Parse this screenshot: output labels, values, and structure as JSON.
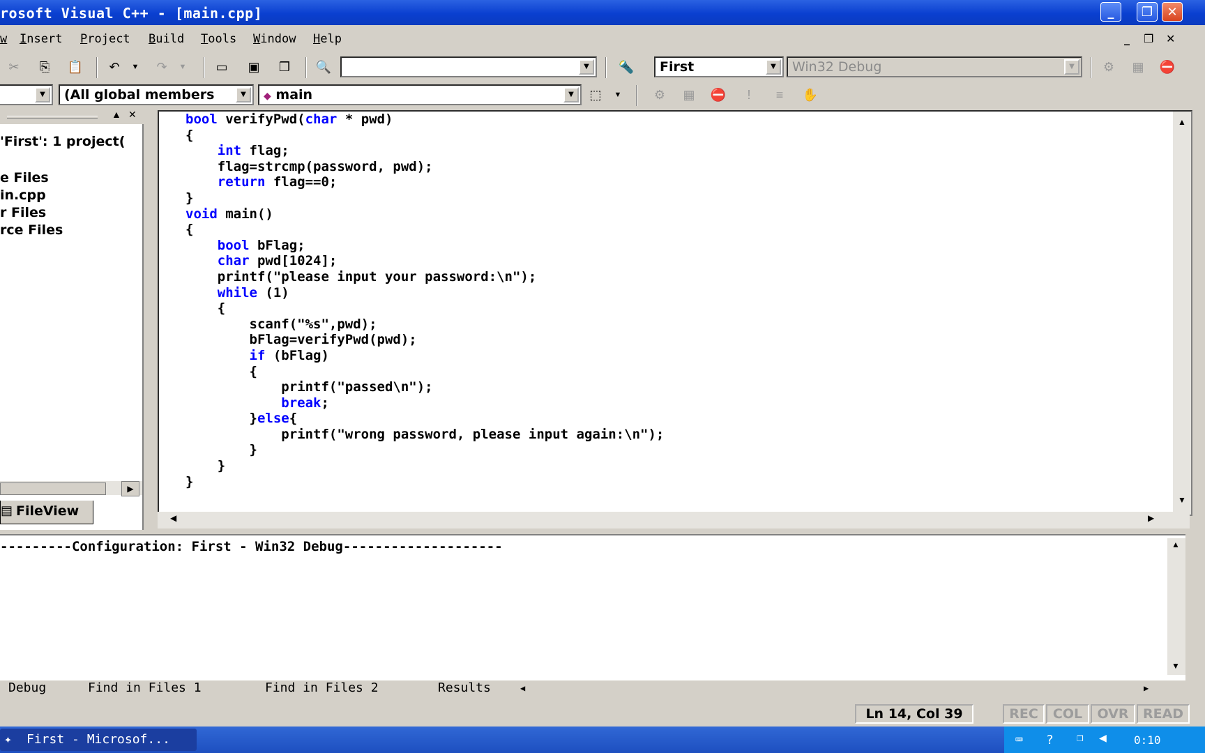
{
  "titlebar": {
    "title": "rosoft Visual C++ - [main.cpp]"
  },
  "menu": [
    "w",
    "Insert",
    "Project",
    "Build",
    "Tools",
    "Window",
    "Help"
  ],
  "toolbar": {
    "find_combo": "",
    "project_combo": "First",
    "config_combo": "Win32 Debug",
    "class_combo": "",
    "members_combo": "(All global members",
    "function_combo": "main"
  },
  "workspace": {
    "root": "'First': 1 project(",
    "items": [
      "e Files",
      "in.cpp",
      "r Files",
      "rce Files"
    ],
    "tab": "FileView"
  },
  "editor": {
    "lines": [
      [
        {
          "t": "bool",
          "k": 1
        },
        {
          "t": " verifyPwd("
        },
        {
          "t": "char",
          "k": 1
        },
        {
          "t": " * pwd)"
        }
      ],
      [
        {
          "t": "{"
        }
      ],
      [
        {
          "t": "    "
        },
        {
          "t": "int",
          "k": 1
        },
        {
          "t": " flag;"
        }
      ],
      [
        {
          "t": "    flag=strcmp(password, pwd);"
        }
      ],
      [
        {
          "t": "    "
        },
        {
          "t": "return",
          "k": 1
        },
        {
          "t": " flag==0;"
        }
      ],
      [
        {
          "t": "}"
        }
      ],
      [
        {
          "t": "void",
          "k": 1
        },
        {
          "t": " main()"
        }
      ],
      [
        {
          "t": "{"
        }
      ],
      [
        {
          "t": "    "
        },
        {
          "t": "bool",
          "k": 1
        },
        {
          "t": " bFlag;"
        }
      ],
      [
        {
          "t": "    "
        },
        {
          "t": "char",
          "k": 1
        },
        {
          "t": " pwd[1024];"
        }
      ],
      [
        {
          "t": "    printf(\"please input your password:\\n\");"
        }
      ],
      [
        {
          "t": "    "
        },
        {
          "t": "while",
          "k": 1
        },
        {
          "t": " (1)"
        }
      ],
      [
        {
          "t": "    {"
        }
      ],
      [
        {
          "t": "        scanf(\"%s\",pwd);"
        }
      ],
      [
        {
          "t": "        bFlag=verifyPwd(pwd);"
        }
      ],
      [
        {
          "t": "        "
        },
        {
          "t": "if",
          "k": 1
        },
        {
          "t": " (bFlag)"
        }
      ],
      [
        {
          "t": "        {"
        }
      ],
      [
        {
          "t": "            printf(\"passed\\n\");"
        }
      ],
      [
        {
          "t": "            "
        },
        {
          "t": "break",
          "k": 1
        },
        {
          "t": ";"
        }
      ],
      [
        {
          "t": "        }"
        },
        {
          "t": "else",
          "k": 1
        },
        {
          "t": "{"
        }
      ],
      [
        {
          "t": "            printf(\"wrong password, please input again:\\n\");"
        }
      ],
      [
        {
          "t": "        }"
        }
      ],
      [
        {
          "t": "    }"
        }
      ],
      [
        {
          "t": "}"
        }
      ]
    ]
  },
  "output": {
    "text": "---------Configuration: First - Win32 Debug--------------------",
    "tabs": [
      "Debug",
      "Find in Files 1",
      "Find in Files 2",
      "Results"
    ]
  },
  "status": {
    "position": "Ln 14, Col 39",
    "indicators": [
      "REC",
      "COL",
      "OVR",
      "READ"
    ]
  },
  "taskbar": {
    "task": "First - Microsof...",
    "clock": "0:10"
  },
  "colors": {
    "keyword": "#0000ff",
    "title_bar": "#0a3fd0",
    "taskbar": "#1d4fc0"
  }
}
